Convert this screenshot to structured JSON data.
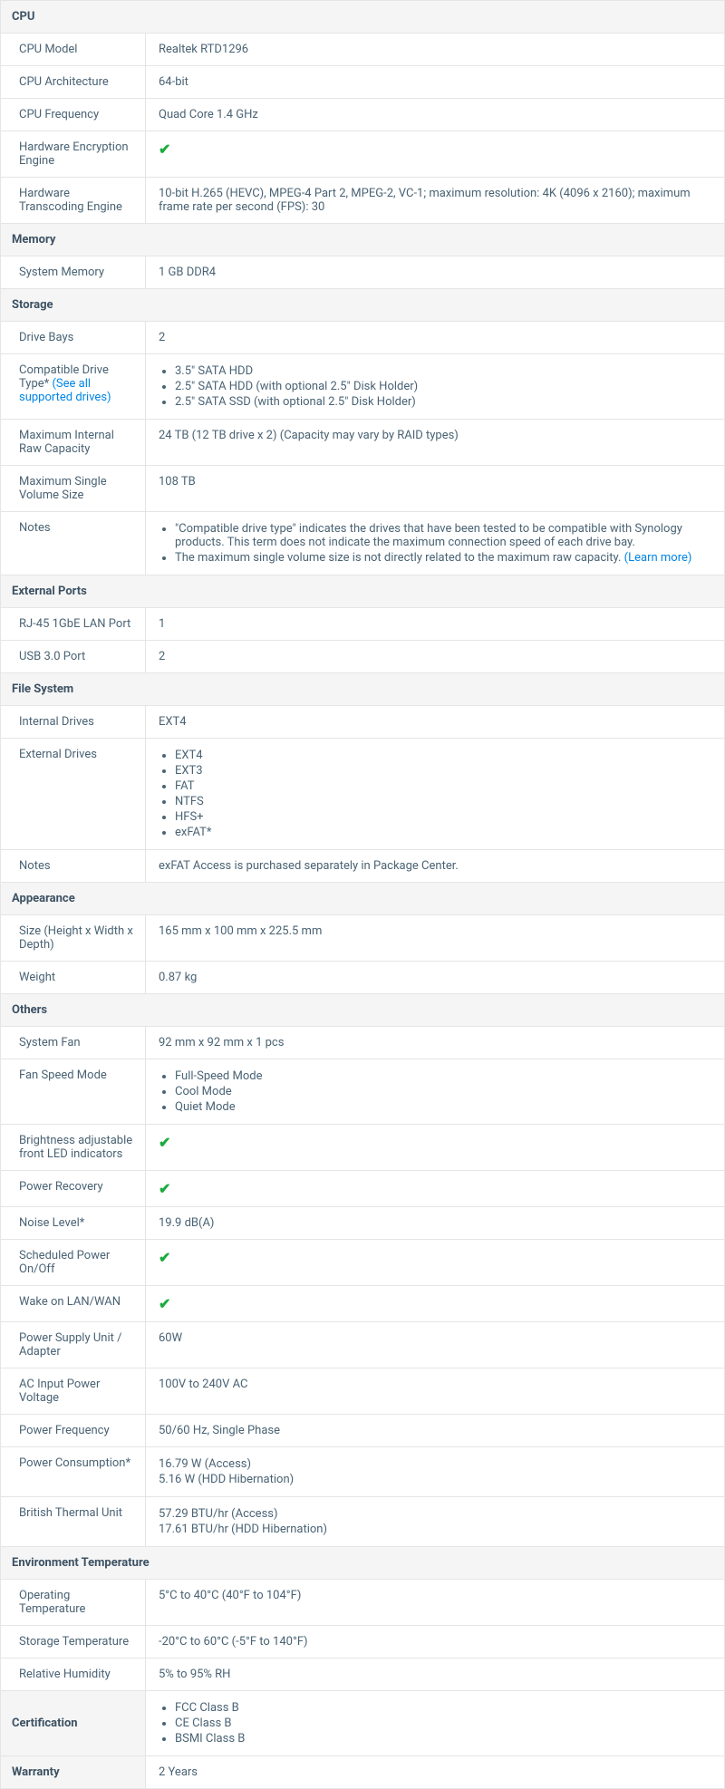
{
  "cpu": {
    "header": "CPU",
    "model_label": "CPU Model",
    "model_value": "Realtek RTD1296",
    "arch_label": "CPU Architecture",
    "arch_value": "64-bit",
    "freq_label": "CPU Frequency",
    "freq_value": "Quad Core 1.4 GHz",
    "hwenc_label": "Hardware Encryption Engine",
    "trans_label": "Hardware Transcoding Engine",
    "trans_value": "10-bit H.265 (HEVC), MPEG-4 Part 2, MPEG-2, VC-1; maximum resolution: 4K (4096 x 2160); maximum frame rate per second (FPS): 30"
  },
  "memory": {
    "header": "Memory",
    "sys_label": "System Memory",
    "sys_value": "1 GB DDR4"
  },
  "storage": {
    "header": "Storage",
    "bays_label": "Drive Bays",
    "bays_value": "2",
    "compat_label_a": "Compatible Drive Type* ",
    "compat_link": "(See all supported drives)",
    "compat_li1": "3.5\" SATA HDD",
    "compat_li2": "2.5\" SATA HDD (with optional 2.5\" Disk Holder)",
    "compat_li3": "2.5\" SATA SSD (with optional 2.5\" Disk Holder)",
    "maxraw_label": "Maximum Internal Raw Capacity",
    "maxraw_value": "24 TB (12 TB drive x 2) (Capacity may vary by RAID types)",
    "maxvol_label": "Maximum Single Volume Size",
    "maxvol_value": "108 TB",
    "notes_label": "Notes",
    "note1": "\"Compatible drive type\" indicates the drives that have been tested to be compatible with Synology products. This term does not indicate the maximum connection speed of each drive bay.",
    "note2_a": "The maximum single volume size is not directly related to the maximum raw capacity. ",
    "note2_link": "(Learn more)"
  },
  "ext": {
    "header": "External Ports",
    "lan_label": "RJ-45 1GbE LAN Port",
    "lan_value": "1",
    "usb_label": "USB 3.0 Port",
    "usb_value": "2"
  },
  "fs": {
    "header": "File System",
    "int_label": "Internal Drives",
    "int_value": "EXT4",
    "ext_label": "External Drives",
    "li1": "EXT4",
    "li2": "EXT3",
    "li3": "FAT",
    "li4": "NTFS",
    "li5": "HFS+",
    "li6": "exFAT*",
    "notes_label": "Notes",
    "notes_value": "exFAT Access is purchased separately in Package Center."
  },
  "app": {
    "header": "Appearance",
    "size_label": "Size (Height x Width x Depth)",
    "size_value": "165 mm x 100 mm x 225.5 mm",
    "weight_label": "Weight",
    "weight_value": "0.87 kg"
  },
  "others": {
    "header": "Others",
    "fan_label": "System Fan",
    "fan_value": "92 mm x 92 mm x 1 pcs",
    "fanmode_label": "Fan Speed Mode",
    "fm1": "Full-Speed Mode",
    "fm2": "Cool Mode",
    "fm3": "Quiet Mode",
    "led_label": "Brightness adjustable front LED indicators",
    "recovery_label": "Power Recovery",
    "noise_label": "Noise Level*",
    "noise_value": "19.9 dB(A)",
    "sched_label": "Scheduled Power On/Off",
    "wol_label": "Wake on LAN/WAN",
    "psu_label": "Power Supply Unit / Adapter",
    "psu_value": "60W",
    "acin_label": "AC Input Power Voltage",
    "acin_value": "100V to 240V AC",
    "pfreq_label": "Power Frequency",
    "pfreq_value": "50/60 Hz, Single Phase",
    "pcons_label": "Power Consumption*",
    "pcons_l1": "16.79 W (Access)",
    "pcons_l2": "5.16 W (HDD Hibernation)",
    "btu_label": "British Thermal Unit",
    "btu_l1": "57.29 BTU/hr (Access)",
    "btu_l2": "17.61 BTU/hr (HDD Hibernation)"
  },
  "env": {
    "header": "Environment Temperature",
    "op_label": "Operating Temperature",
    "op_value": "5°C to 40°C (40°F to 104°F)",
    "st_label": "Storage Temperature",
    "st_value": "-20°C to 60°C (-5°F to 140°F)",
    "rh_label": "Relative Humidity",
    "rh_value": "5% to 95% RH"
  },
  "cert": {
    "header": "Certification",
    "li1": "FCC Class B",
    "li2": "CE Class B",
    "li3": "BSMI Class B"
  },
  "warranty": {
    "header": "Warranty",
    "value": "2 Years"
  }
}
